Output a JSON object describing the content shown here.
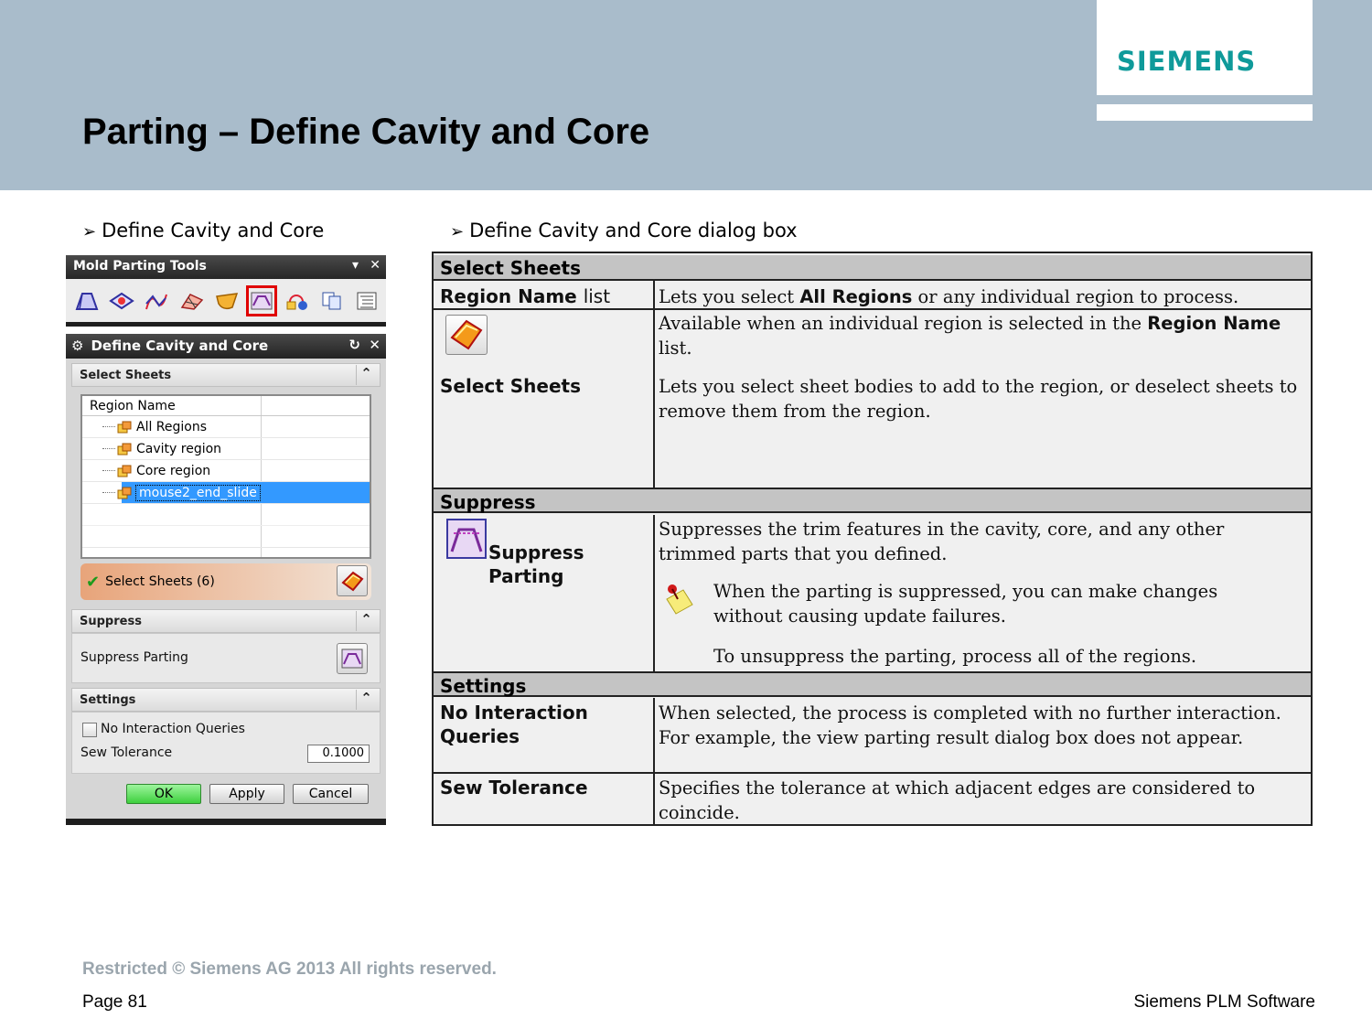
{
  "brand": {
    "logo": "SIEMENS",
    "color": "#0f9a9a"
  },
  "slide": {
    "title": "Parting – Define Cavity and Core"
  },
  "bullets": {
    "left": "Define Cavity and Core",
    "right": "Define Cavity and Core dialog box"
  },
  "toolbar": {
    "title": "Mold Parting Tools",
    "icons": [
      "region-analysis-icon",
      "design-parting-surface-icon",
      "guide-lines-icon",
      "patch-surface-icon",
      "parting-surface-icon",
      "define-cavity-and-core-icon",
      "swap-model-icon",
      "copy-icon",
      "navigator-icon"
    ],
    "selected_icon": "define-cavity-and-core-icon"
  },
  "dialog": {
    "title": "Define Cavity and Core",
    "select_sheets": {
      "header": "Select Sheets",
      "list_header": "Region Name",
      "regions": [
        "All Regions",
        "Cavity region",
        "Core region",
        "mouse2_end_slide"
      ],
      "selected_region": "mouse2_end_slide",
      "select_label": "Select Sheets (6)"
    },
    "suppress": {
      "header": "Suppress",
      "label": "Suppress Parting"
    },
    "settings": {
      "header": "Settings",
      "no_interaction_label": "No Interaction Queries",
      "no_interaction_checked": false,
      "sew_tolerance_label": "Sew Tolerance",
      "sew_tolerance_value": "0.1000"
    },
    "buttons": {
      "ok": "OK",
      "apply": "Apply",
      "cancel": "Cancel"
    }
  },
  "reference": {
    "sections": [
      {
        "header": "Select Sheets",
        "rows": [
          {
            "term_bold": "Region Name",
            "term_light": "list",
            "desc": [
              "Lets you select ",
              "All Regions",
              " or any individual region to process."
            ]
          },
          {
            "term": "Select Sheets",
            "desc1": [
              "Available when an individual region is selected in the ",
              "Region Name",
              " list."
            ],
            "desc2": "Lets you select sheet bodies to add to the region, or deselect sheets to remove them from the region."
          }
        ]
      },
      {
        "header": "Suppress",
        "rows": [
          {
            "term": "Suppress Parting",
            "desc": "Suppresses the trim features in the cavity, core, and any other trimmed parts that you defined.",
            "note1": "When the parting is suppressed, you can make changes without causing update failures.",
            "note2": "To unsuppress the parting, process all of the regions."
          }
        ]
      },
      {
        "header": "Settings",
        "rows": [
          {
            "term": "No Interaction Queries",
            "desc": "When selected, the process is completed with no further interaction. For example, the view parting result dialog box does not appear."
          },
          {
            "term": "Sew Tolerance",
            "desc": "Specifies the tolerance at which adjacent edges are considered to coincide."
          }
        ]
      }
    ]
  },
  "footer": {
    "restricted": "Restricted © Siemens AG 2013 All rights reserved.",
    "page": "Page 81",
    "brand": "Siemens PLM Software"
  }
}
